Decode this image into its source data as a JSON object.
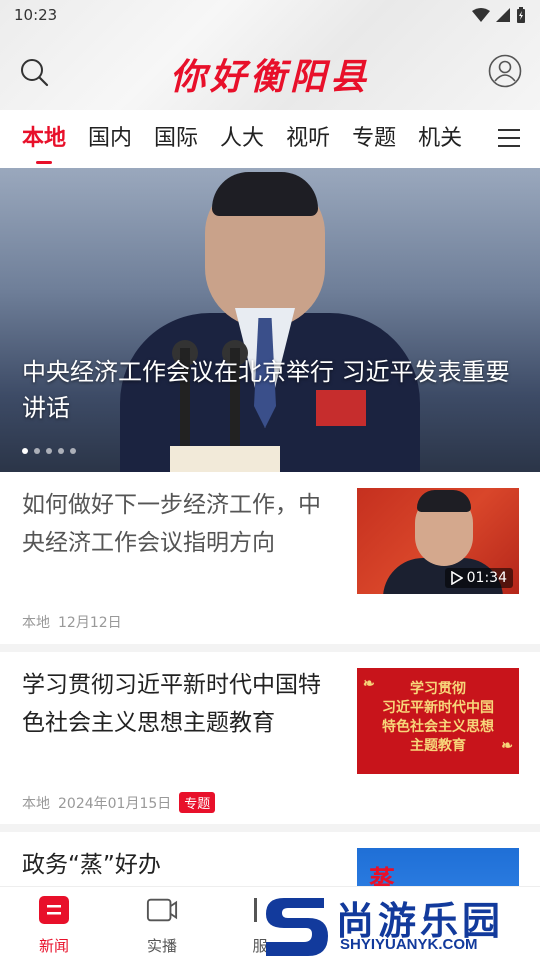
{
  "status": {
    "time": "10:23"
  },
  "header": {
    "logo": "你好衡阳县"
  },
  "tabs": [
    "本地",
    "国内",
    "国际",
    "人大",
    "视听",
    "专题",
    "机关"
  ],
  "hero": {
    "caption": "中央经济工作会议在北京举行 习近平发表重要讲话",
    "slides": 5,
    "current": 1
  },
  "news": [
    {
      "title": "如何做好下一步经济工作，中央经济工作会议指明方向",
      "source": "本地",
      "date": "12月12日",
      "duration": "01:34"
    },
    {
      "title": "学习贯彻习近平新时代中国特色社会主义思想主题教育",
      "source": "本地",
      "date": "2024年01月15日",
      "tag": "专题",
      "thumb_lines": [
        "学习贯彻",
        "习近平新时代中国",
        "特色社会主义思想",
        "主题教育"
      ]
    },
    {
      "title": "政务“蒸”好办",
      "thumb_text": "蒸"
    }
  ],
  "bottom_nav": [
    {
      "label": "新闻",
      "icon": "news-icon",
      "active": true
    },
    {
      "label": "实播",
      "icon": "video-camera-icon"
    },
    {
      "label": "服",
      "icon": "service-icon"
    }
  ],
  "watermark": {
    "big": "尚游乐园",
    "small": "SHYIYUANYK.COM"
  },
  "colors": {
    "brand_red": "#e8102a",
    "watermark_blue": "#123a9c"
  }
}
